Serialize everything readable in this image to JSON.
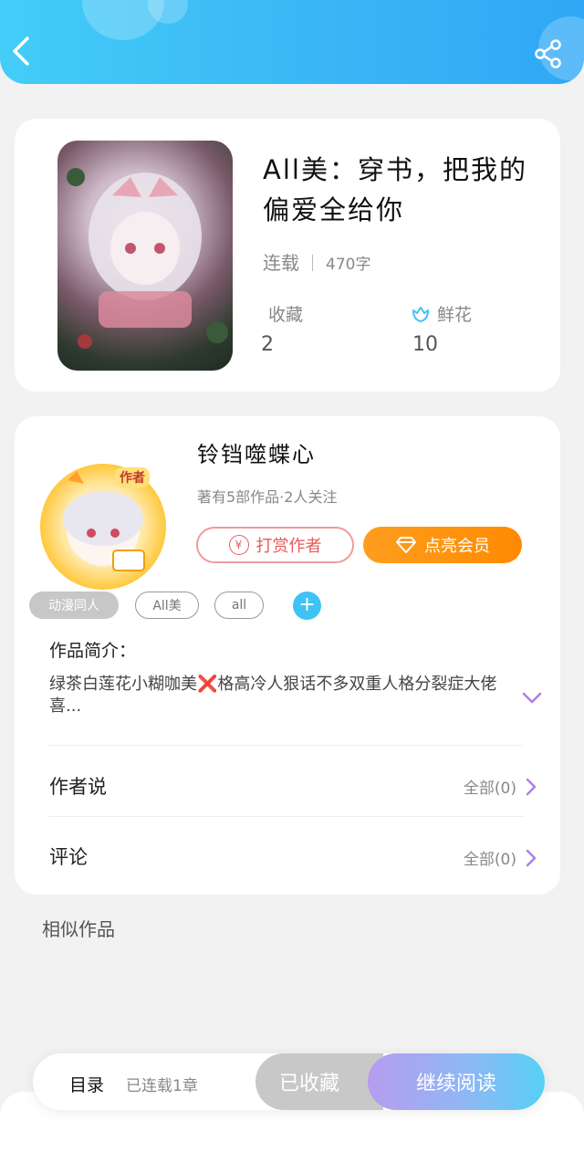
{
  "book": {
    "title": "All美：穿书，把我的偏爱全给你",
    "status": "连载",
    "word_count": "470字",
    "collect_label": "收藏",
    "collect_count": "2",
    "flower_label": "鲜花",
    "flower_count": "10"
  },
  "author": {
    "avatar_badge": "作者",
    "name": "铃铛噬蝶心",
    "stats": "著有5部作品·2人关注",
    "reward_label": "打赏作者",
    "reward_icon": "¥",
    "vip_label": "点亮会员"
  },
  "tags": [
    "动漫同人",
    "All美",
    "all"
  ],
  "tag_add": "+",
  "intro": {
    "label": "作品简介：",
    "text": "绿茶白莲花小糊咖美❌格高冷人狠话不多双重人格分裂症大佬喜..."
  },
  "author_says": {
    "label": "作者说",
    "link": "全部(0)"
  },
  "comments": {
    "label": "评论",
    "link": "全部(0)"
  },
  "similar_title": "相似作品",
  "bottom_bar": {
    "toc_label": "目录",
    "toc_count": "已连载1章",
    "collected_label": "已收藏",
    "continue_label": "继续阅读"
  },
  "colors": {
    "header": "#3ab8f6",
    "vip": "#ff8f0a",
    "reward": "#e85a5a",
    "accent_purple": "#b07ee8",
    "tag_add": "#3fc3f4"
  }
}
